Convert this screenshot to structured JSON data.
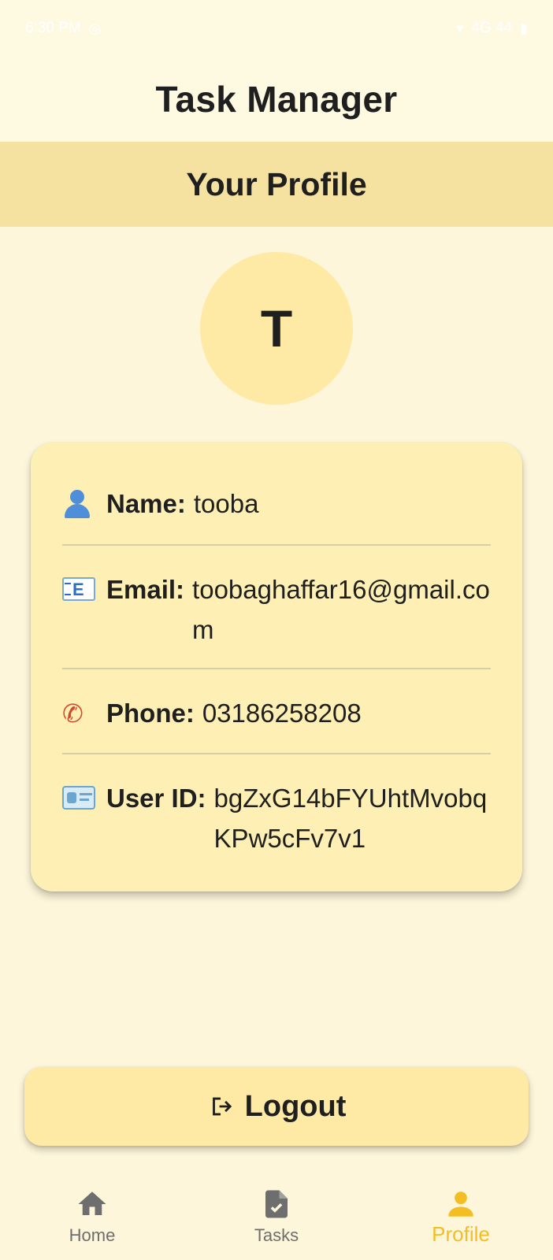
{
  "status_bar": {
    "time": "6:30 PM",
    "right_text": "4G 44"
  },
  "app_bar": {
    "title": "Task Manager"
  },
  "section": {
    "title": "Your Profile"
  },
  "avatar": {
    "initial": "T"
  },
  "profile": {
    "rows": [
      {
        "icon": "person-icon",
        "label": "Name:",
        "value": "tooba"
      },
      {
        "icon": "email-icon",
        "label": "Email:",
        "value": "toobaghaffar16@gmail.com"
      },
      {
        "icon": "phone-icon",
        "label": "Phone:",
        "value": "03186258208"
      },
      {
        "icon": "id-card-icon",
        "label": "User ID:",
        "value": "bgZxG14bFYUhtMvobqKPw5cFv7v1"
      }
    ]
  },
  "logout": {
    "label": "Logout",
    "icon": "logout-icon"
  },
  "nav": {
    "items": [
      {
        "label": "Home",
        "icon": "home-icon",
        "active": false
      },
      {
        "label": "Tasks",
        "icon": "tasks-icon",
        "active": false
      },
      {
        "label": "Profile",
        "icon": "profile-icon",
        "active": true
      }
    ]
  },
  "colors": {
    "background": "#fdf6da",
    "header_band": "#f5e1a0",
    "card": "#fef0b4",
    "accent": "#f4bd22",
    "inactive": "#6e6e6e"
  }
}
